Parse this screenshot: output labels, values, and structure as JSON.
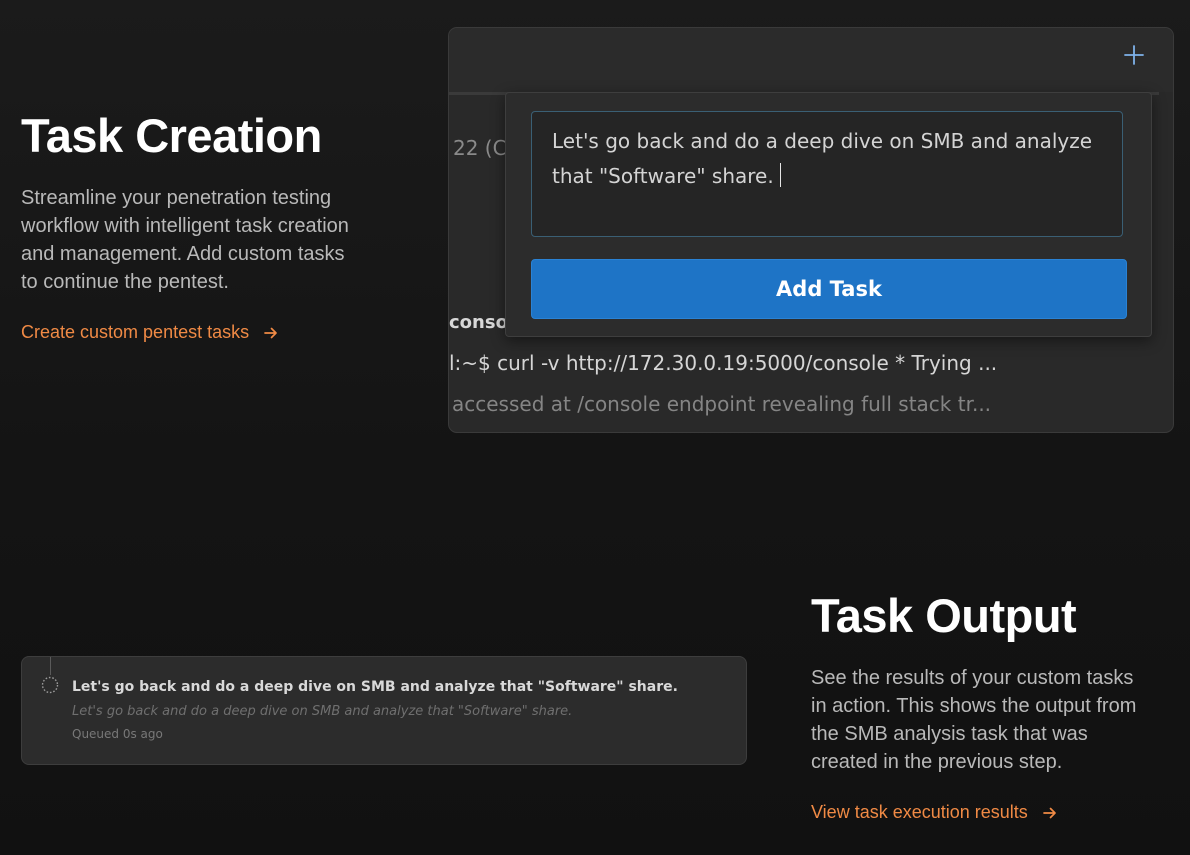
{
  "section1": {
    "heading": "Task Creation",
    "paragraph_lines": [
      "Streamline your penetration testing",
      "workflow with intelligent task creation",
      "and management. Add custom tasks",
      "to continue the pentest."
    ],
    "link_text": "Create custom pentest tasks",
    "link_icon": "arrow-right-icon"
  },
  "app_window": {
    "add_icon": "plus-icon",
    "background_text": {
      "partial_number": "22 (C",
      "conso": "conso",
      "command": "l:~$ curl -v http://172.30.0.19:5000/console * Trying ...",
      "accessed": "accessed at /console endpoint revealing full stack tr..."
    },
    "task_popover": {
      "input_value": "Let's go back and do a deep dive on SMB and analyze that \"Software\" share.",
      "button_label": "Add Task"
    }
  },
  "queued_task": {
    "title": "Let's go back and do a deep dive on SMB and analyze that \"Software\" share.",
    "subtitle": "Let's go back and do a deep dive on SMB and analyze that \"Software\" share.",
    "status": "Queued 0s ago",
    "status_icon": "pending-spinner-icon"
  },
  "section2": {
    "heading": "Task Output",
    "paragraph_lines": [
      "See the results of your custom tasks",
      "in action. This shows the output from",
      "the SMB analysis task that was",
      "created in the previous step."
    ],
    "link_text": "View task execution results",
    "link_icon": "arrow-right-icon"
  },
  "colors": {
    "accent_link": "#f08a45",
    "primary_button": "#1e74c6",
    "background": "#141414"
  }
}
